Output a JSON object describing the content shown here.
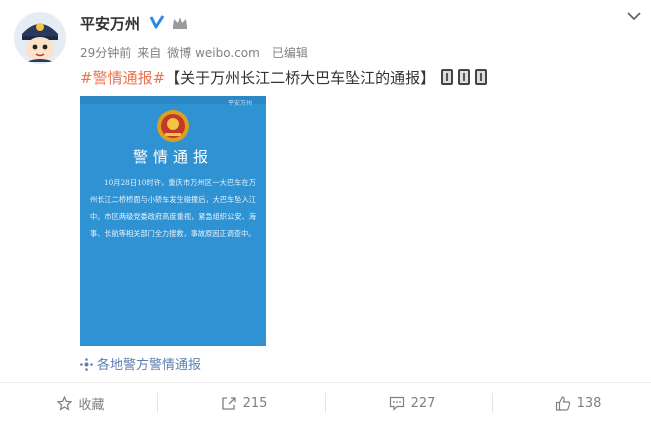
{
  "author": {
    "name": "平安万州"
  },
  "meta": {
    "time": "29分钟前",
    "source_prefix": "来自",
    "source": "微博 weibo.com",
    "edited": "已编辑"
  },
  "post": {
    "topic": "#警情通报#",
    "text": "【关于万州长江二桥大巴车坠江的通报】"
  },
  "card": {
    "logo_text": "平安万州",
    "title": "警情通报",
    "body": "10月28日10时许，重庆市万州区一大巴车在万州长江二桥桥面与小轿车发生碰撞后，大巴车坠入江中。市区两级党委政府高度重视，紧急组织公安、海事、长航等相关部门全力搜救，事故原因正调查中。"
  },
  "source_link": "各地警方警情通报",
  "actions": {
    "favorite_label": "收藏",
    "repost_count": "215",
    "comment_count": "227",
    "like_count": "138"
  },
  "colors": {
    "topic": "#eb7350",
    "card_bg": "#2f92d3",
    "link": "#5d7fb0"
  }
}
